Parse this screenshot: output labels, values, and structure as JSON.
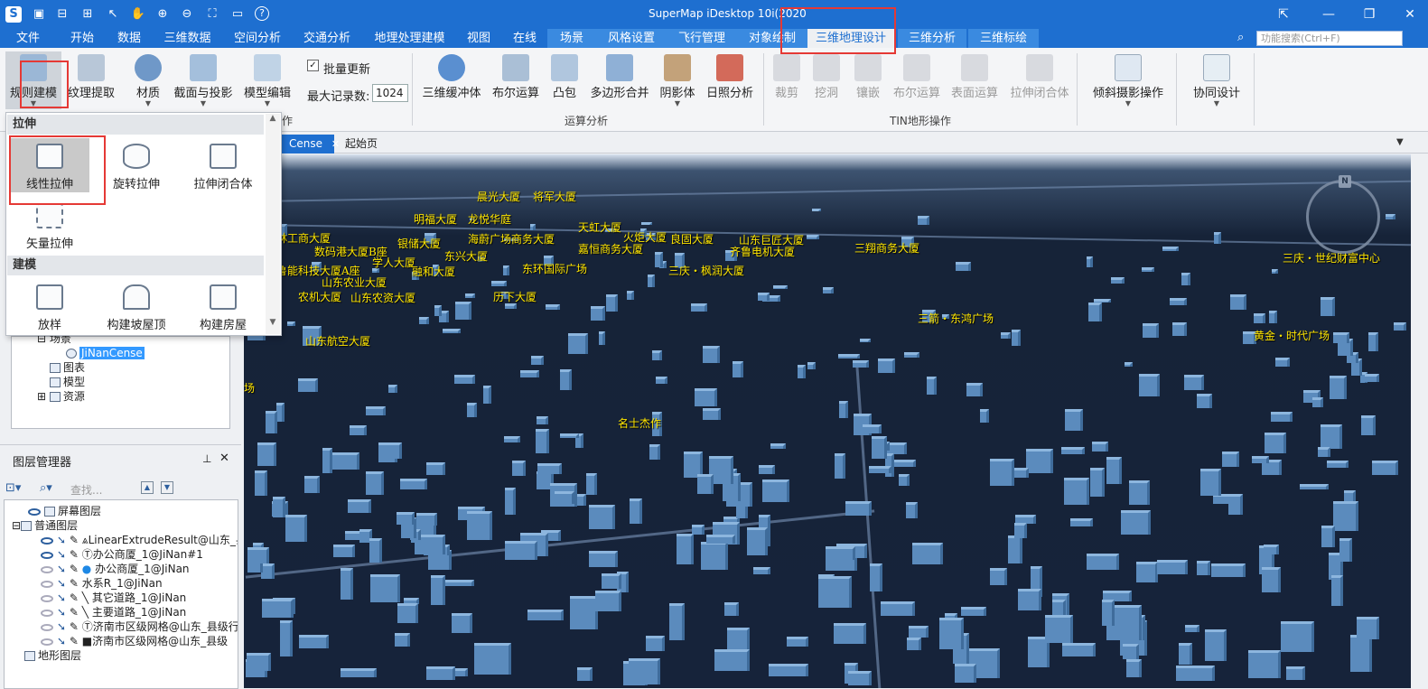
{
  "app": {
    "title": "SuperMap iDesktop 10i(2020"
  },
  "quick_access": [
    "logo-icon",
    "save-icon",
    "open-icon",
    "import-icon",
    "pointer-icon",
    "pan-icon",
    "zoom-in-icon",
    "zoom-out-icon",
    "full-extent-icon",
    "folder-icon",
    "help-icon"
  ],
  "menu_tabs": [
    "文件",
    "开始",
    "数据",
    "三维数据",
    "空间分析",
    "交通分析",
    "地理处理建模",
    "视图",
    "在线",
    "场景",
    "风格设置",
    "飞行管理",
    "对象绘制",
    "三维地理设计",
    "三维分析",
    "三维标绘"
  ],
  "active_tab": "三维地理设计",
  "search": {
    "placeholder": "功能搜索(Ctrl+F)"
  },
  "ribbon": {
    "modeling": [
      "规则建模",
      "纹理提取",
      "材质",
      "截面与投影",
      "模型编辑"
    ],
    "batch_update_label": "批量更新",
    "max_records_label": "最大记录数:",
    "max_records_value": "1024",
    "ops_group": {
      "label": "运算分析",
      "buttons": [
        "三维缓冲体",
        "布尔运算",
        "凸包",
        "多边形合并",
        "阴影体",
        "日照分析"
      ]
    },
    "tin_group": {
      "label": "TIN地形操作",
      "buttons": [
        "裁剪",
        "挖洞",
        "镶嵌",
        "布尔运算",
        "表面运算",
        "拉伸闭合体"
      ]
    },
    "oblique_label": "倾斜摄影操作",
    "collab_label": "协同设计",
    "partial_group_label": "作"
  },
  "dropdown": {
    "section_extrude": "拉伸",
    "extrude_items": [
      "线性拉伸",
      "旋转拉伸",
      "拉伸闭合体",
      "矢量拉伸"
    ],
    "section_model": "建模",
    "model_items": [
      "放样",
      "构建坡屋顶",
      "构建房屋"
    ]
  },
  "workspace_tree": {
    "scenes_label": "场景",
    "scene_name": "JiNanCense",
    "layouts_label": "图表",
    "models_label": "模型",
    "resources_label": "资源"
  },
  "layer_manager": {
    "title": "图层管理器",
    "search_placeholder": "查找...",
    "screen_layers": "屏幕图层",
    "normal_layers": "普通图层",
    "layers": [
      "LinearExtrudeResult@山东_县",
      "办公商厦_1@JiNan#1",
      "办公商厦_1@JiNan",
      "水系R_1@JiNan",
      "其它道路_1@JiNan",
      "主要道路_1@JiNan",
      "济南市区级网格@山东_县级行政",
      "济南市区级网格@山东_县级"
    ],
    "terrain_layers": "地形图层"
  },
  "doc_tabs": [
    "Cense",
    "起始页"
  ],
  "scene_labels": [
    "晨光大厦",
    "将军大厦",
    "明福大厦",
    "龙悦华庭",
    "天虹大厦",
    "银储大厦",
    "海蔚广场商务大厦",
    "火炬大厦",
    "良固大厦",
    "山东巨匠大厦",
    "数码港大厦B座",
    "学人大厦",
    "东兴大厦",
    "嘉恒商务大厦",
    "齐鲁电机大厦",
    "三翔商务大厦",
    "林工商大厦",
    "鲁能科技大厦A座",
    "融和大厦",
    "东环国际广场",
    "三庆・枫润大厦",
    "山东农业大厦",
    "农机大厦",
    "山东农资大厦",
    "历下大厦",
    "三箭・东鸿广场",
    "山东航空大厦",
    "名士杰作",
    "三庆・世纪财富中心",
    "黄金・时代广场",
    "场"
  ],
  "compass_label": "N"
}
